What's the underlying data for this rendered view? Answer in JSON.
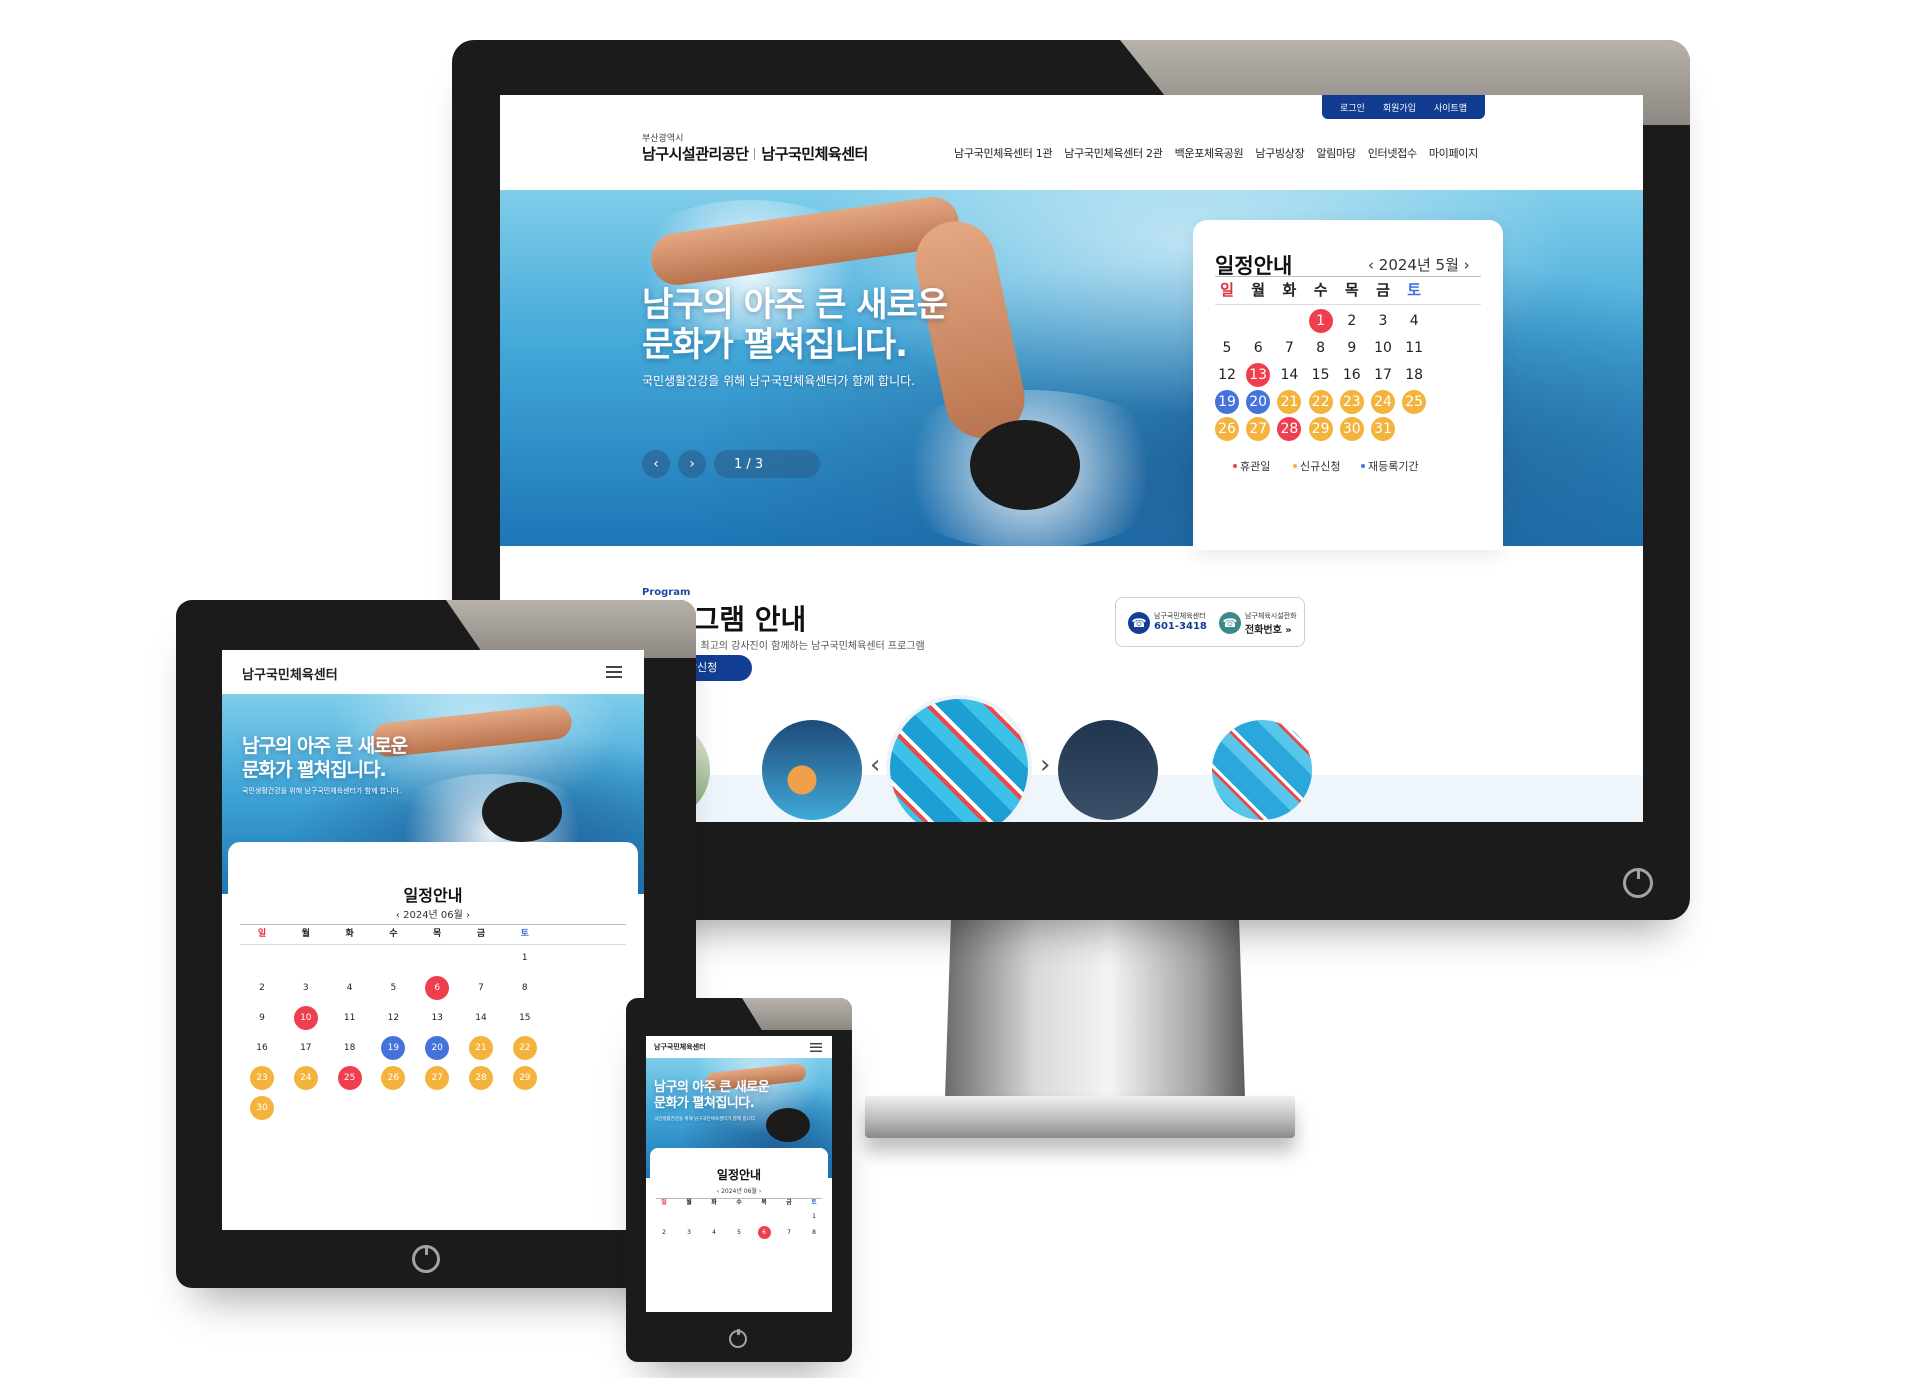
{
  "desktop": {
    "utility_links": [
      "로그인",
      "회원가입",
      "사이트맵"
    ],
    "logo_small": "부산광역시",
    "logo_org": "남구시설관리공단",
    "logo_site": "남구국민체육센터",
    "nav": [
      "남구국민체육센터 1관",
      "남구국민체육센터 2관",
      "백운포체육공원",
      "남구빙상장",
      "알림마당",
      "인터넷접수",
      "마이페이지"
    ],
    "hero": {
      "title_line1": "남구의 아주 큰 새로운",
      "title_line2": "문화가 펼쳐집니다.",
      "subtitle": "국민생활건강을 위해 남구국민체육센터가 함께 합니다.",
      "prev_icon": "chevron-left-icon",
      "next_icon": "chevron-right-icon",
      "pager": "1 / 3"
    },
    "calendar": {
      "title": "일정안내",
      "month": "2024년 5월",
      "weekdays": [
        "일",
        "월",
        "화",
        "수",
        "목",
        "금",
        "토"
      ],
      "days": [
        {
          "d": "1",
          "col": 3,
          "row": 0,
          "mark": "red"
        },
        {
          "d": "2",
          "col": 4,
          "row": 0
        },
        {
          "d": "3",
          "col": 5,
          "row": 0
        },
        {
          "d": "4",
          "col": 6,
          "row": 0
        },
        {
          "d": "5",
          "col": 0,
          "row": 1
        },
        {
          "d": "6",
          "col": 1,
          "row": 1
        },
        {
          "d": "7",
          "col": 2,
          "row": 1
        },
        {
          "d": "8",
          "col": 3,
          "row": 1
        },
        {
          "d": "9",
          "col": 4,
          "row": 1
        },
        {
          "d": "10",
          "col": 5,
          "row": 1
        },
        {
          "d": "11",
          "col": 6,
          "row": 1
        },
        {
          "d": "12",
          "col": 0,
          "row": 2
        },
        {
          "d": "13",
          "col": 1,
          "row": 2,
          "mark": "red"
        },
        {
          "d": "14",
          "col": 2,
          "row": 2
        },
        {
          "d": "15",
          "col": 3,
          "row": 2
        },
        {
          "d": "16",
          "col": 4,
          "row": 2
        },
        {
          "d": "17",
          "col": 5,
          "row": 2
        },
        {
          "d": "18",
          "col": 6,
          "row": 2
        },
        {
          "d": "19",
          "col": 0,
          "row": 3,
          "mark": "blue"
        },
        {
          "d": "20",
          "col": 1,
          "row": 3,
          "mark": "blue"
        },
        {
          "d": "21",
          "col": 2,
          "row": 3,
          "mark": "orange"
        },
        {
          "d": "22",
          "col": 3,
          "row": 3,
          "mark": "orange"
        },
        {
          "d": "23",
          "col": 4,
          "row": 3,
          "mark": "orange"
        },
        {
          "d": "24",
          "col": 5,
          "row": 3,
          "mark": "orange"
        },
        {
          "d": "25",
          "col": 6,
          "row": 3,
          "mark": "orange"
        },
        {
          "d": "26",
          "col": 0,
          "row": 4,
          "mark": "orange"
        },
        {
          "d": "27",
          "col": 1,
          "row": 4,
          "mark": "orange"
        },
        {
          "d": "28",
          "col": 2,
          "row": 4,
          "mark": "red"
        },
        {
          "d": "29",
          "col": 3,
          "row": 4,
          "mark": "orange"
        },
        {
          "d": "30",
          "col": 4,
          "row": 4,
          "mark": "orange"
        },
        {
          "d": "31",
          "col": 5,
          "row": 4,
          "mark": "orange"
        }
      ],
      "legend": [
        "휴관일",
        "신규신청",
        "재등록기간"
      ]
    },
    "program": {
      "label": "Program",
      "title": "프로그램 안내",
      "desc": "최신시설에서 최고의 강사진이 함께하는 남구국민체육센터 프로그램",
      "button": "수강신청"
    },
    "contacts": [
      {
        "label": "남구국민체육센터",
        "value": "601-3418",
        "icon": "phone-icon"
      },
      {
        "label": "남구체육시설전화",
        "value": "전화번호 »",
        "icon": "phone-icon"
      }
    ],
    "carousel": {
      "prev_icon": "chevron-left-icon",
      "next_icon": "chevron-right-icon"
    }
  },
  "tablet": {
    "site_title": "남구국민체육센터",
    "menu_icon": "hamburger-menu-icon",
    "hero_title_line1": "남구의 아주 큰 새로운",
    "hero_title_line2": "문화가 펼쳐집니다.",
    "hero_subtitle": "국민생활건강을 위해 남구국민체육센터가 함께 합니다.",
    "calendar_title": "일정안내",
    "calendar_month": "2024년 06월",
    "weekdays": [
      "일",
      "월",
      "화",
      "수",
      "목",
      "금",
      "토"
    ],
    "days": [
      {
        "d": "1",
        "col": 6,
        "row": 0
      },
      {
        "d": "2",
        "col": 0,
        "row": 1
      },
      {
        "d": "3",
        "col": 1,
        "row": 1
      },
      {
        "d": "4",
        "col": 2,
        "row": 1
      },
      {
        "d": "5",
        "col": 3,
        "row": 1
      },
      {
        "d": "6",
        "col": 4,
        "row": 1,
        "mark": "red"
      },
      {
        "d": "7",
        "col": 5,
        "row": 1
      },
      {
        "d": "8",
        "col": 6,
        "row": 1
      },
      {
        "d": "9",
        "col": 0,
        "row": 2
      },
      {
        "d": "10",
        "col": 1,
        "row": 2,
        "mark": "red"
      },
      {
        "d": "11",
        "col": 2,
        "row": 2
      },
      {
        "d": "12",
        "col": 3,
        "row": 2
      },
      {
        "d": "13",
        "col": 4,
        "row": 2
      },
      {
        "d": "14",
        "col": 5,
        "row": 2
      },
      {
        "d": "15",
        "col": 6,
        "row": 2
      },
      {
        "d": "16",
        "col": 0,
        "row": 3
      },
      {
        "d": "17",
        "col": 1,
        "row": 3
      },
      {
        "d": "18",
        "col": 2,
        "row": 3
      },
      {
        "d": "19",
        "col": 3,
        "row": 3,
        "mark": "blue"
      },
      {
        "d": "20",
        "col": 4,
        "row": 3,
        "mark": "blue"
      },
      {
        "d": "21",
        "col": 5,
        "row": 3,
        "mark": "orange"
      },
      {
        "d": "22",
        "col": 6,
        "row": 3,
        "mark": "orange"
      },
      {
        "d": "23",
        "col": 0,
        "row": 4,
        "mark": "orange"
      },
      {
        "d": "24",
        "col": 1,
        "row": 4,
        "mark": "orange"
      },
      {
        "d": "25",
        "col": 2,
        "row": 4,
        "mark": "red"
      },
      {
        "d": "26",
        "col": 3,
        "row": 4,
        "mark": "orange"
      },
      {
        "d": "27",
        "col": 4,
        "row": 4,
        "mark": "orange"
      },
      {
        "d": "28",
        "col": 5,
        "row": 4,
        "mark": "orange"
      },
      {
        "d": "29",
        "col": 6,
        "row": 4,
        "mark": "orange"
      },
      {
        "d": "30",
        "col": 0,
        "row": 5,
        "mark": "orange"
      }
    ]
  },
  "phone": {
    "site_title": "남구국민체육센터",
    "menu_icon": "hamburger-menu-icon",
    "hero_title_line1": "남구의 아주 큰 새로운",
    "hero_title_line2": "문화가 펼쳐집니다.",
    "hero_subtitle": "국민생활건강을 위해 남구국민체육센터가 함께 합니다.",
    "calendar_title": "일정안내",
    "calendar_month": "2024년 06월",
    "weekdays": [
      "일",
      "월",
      "화",
      "수",
      "목",
      "금",
      "토"
    ],
    "days": [
      {
        "d": "1",
        "col": 6,
        "row": 0
      },
      {
        "d": "2",
        "col": 0,
        "row": 1
      },
      {
        "d": "3",
        "col": 1,
        "row": 1
      },
      {
        "d": "4",
        "col": 2,
        "row": 1
      },
      {
        "d": "5",
        "col": 3,
        "row": 1
      },
      {
        "d": "6",
        "col": 4,
        "row": 1,
        "mark": "red"
      },
      {
        "d": "7",
        "col": 5,
        "row": 1
      },
      {
        "d": "8",
        "col": 6,
        "row": 1
      }
    ]
  },
  "colors": {
    "red": "#ef3f4e",
    "blue": "#4573db",
    "orange": "#f4b33c",
    "navy": "#123f93",
    "sunday": "#e0303c",
    "saturday": "#3d6fdc"
  }
}
